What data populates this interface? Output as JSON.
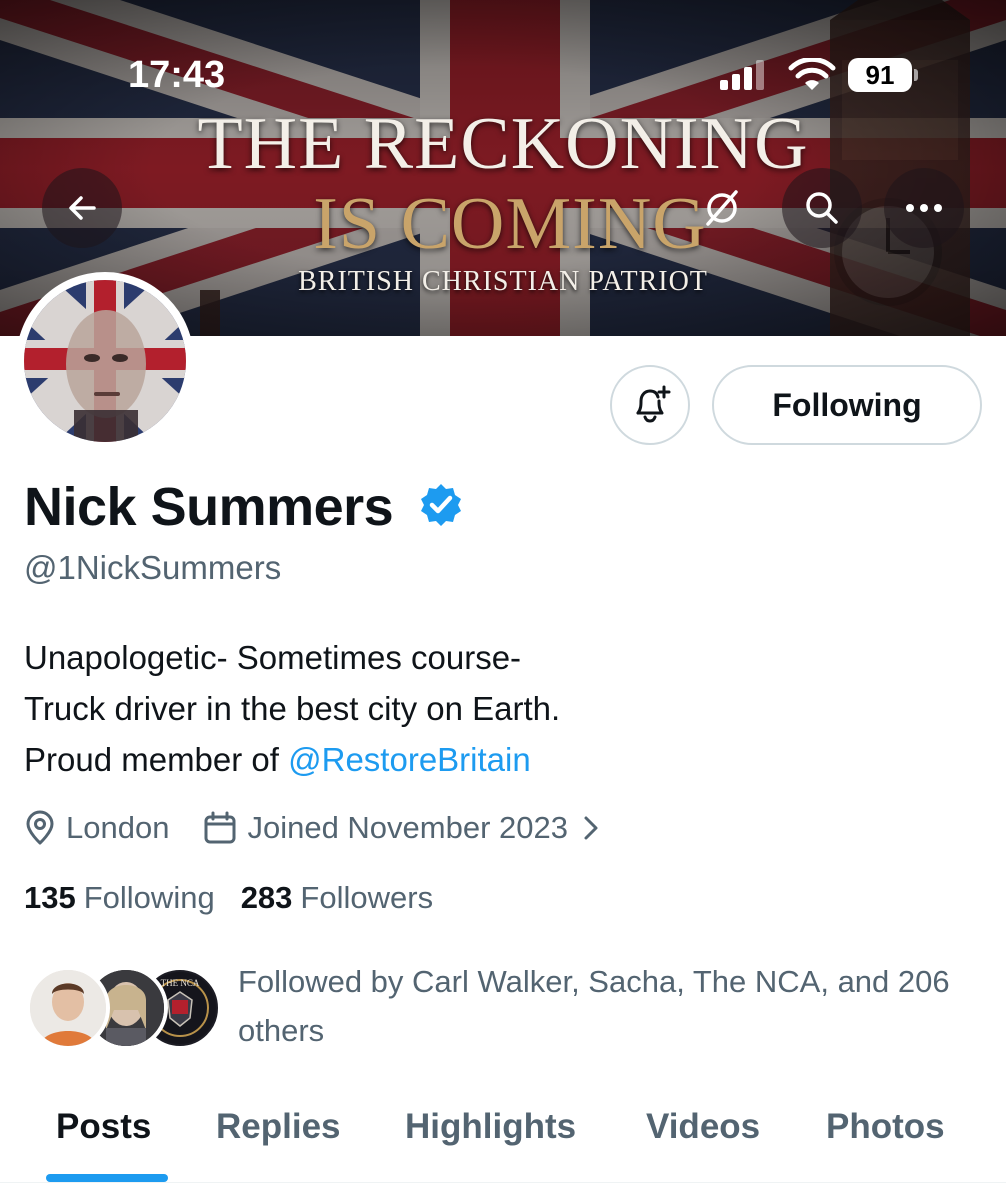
{
  "status_bar": {
    "time": "17:43",
    "battery": "91",
    "icons": [
      "signal-icon",
      "wifi-icon",
      "battery-icon"
    ]
  },
  "banner": {
    "line1": "THE RECKONING",
    "line2": "IS COMING",
    "line3": "BRITISH CHRISTIAN PATRIOT"
  },
  "nav": {
    "back_icon": "arrow-left-icon",
    "grok_icon": "slash-circle-icon",
    "search_icon": "search-icon",
    "more_icon": "more-icon"
  },
  "actions": {
    "notify_icon": "bell-plus-icon",
    "following_label": "Following"
  },
  "profile": {
    "display_name": "Nick Summers",
    "verified": true,
    "handle": "@1NickSummers",
    "bio_line1": "Unapologetic- Sometimes course-",
    "bio_line2": "Truck driver in the best city on Earth.",
    "bio_line3_prefix": "Proud member of ",
    "bio_line3_mention": "@RestoreBritain",
    "location": "London",
    "joined": "Joined November 2023",
    "following_count": "135",
    "following_label": "Following",
    "followers_count": "283",
    "followers_label": "Followers",
    "followed_by": "Followed by Carl Walker, Sacha, The NCA, and 206 others",
    "followed_by_avatar_text": "THE NCA"
  },
  "tabs": [
    {
      "label": "Posts",
      "active": true
    },
    {
      "label": "Replies",
      "active": false
    },
    {
      "label": "Highlights",
      "active": false
    },
    {
      "label": "Videos",
      "active": false
    },
    {
      "label": "Photos",
      "active": false
    }
  ],
  "colors": {
    "accent": "#1d9bf0",
    "text_primary": "#0f1419",
    "text_secondary": "#536471",
    "border": "#cfd9de"
  }
}
